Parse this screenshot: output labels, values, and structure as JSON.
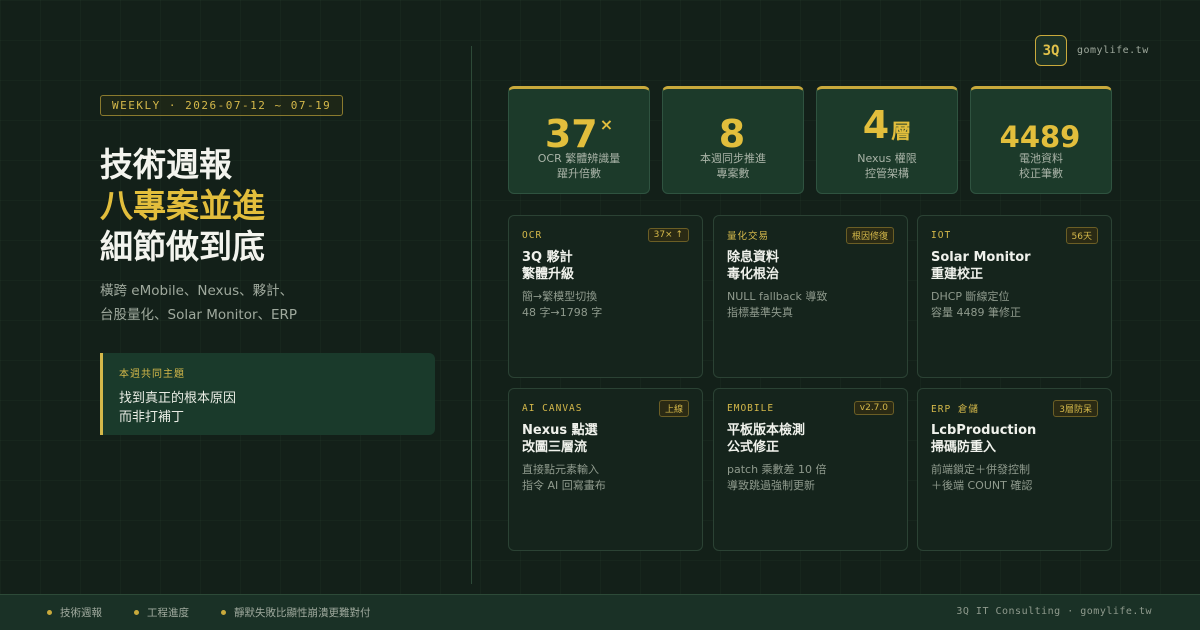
{
  "left": {
    "weekly_tag": "WEEKLY · 2026-07-12 ~ 07-19",
    "headline": [
      "技術週報",
      "八專案並進",
      "細節做到底"
    ],
    "intro": [
      "橫跨 eMobile、Nexus、夥計、",
      "台股量化、Solar Monitor、ERP"
    ],
    "theme_label": "本週共同主題",
    "theme_lines": [
      "找到真正的根本原因",
      "而非打補丁"
    ]
  },
  "brand": {
    "logo": "3Q",
    "url": "gomylife.tw"
  },
  "stats": [
    {
      "value": "37",
      "suffix": "×",
      "label": [
        "OCR 繁體辨識量",
        "躍升倍數"
      ]
    },
    {
      "value": "8",
      "suffix": "",
      "label": [
        "本週同步推進",
        "專案數"
      ]
    },
    {
      "value": "4",
      "suffix": "層",
      "label": [
        "Nexus 權限",
        "控管架構"
      ]
    },
    {
      "value": "4489",
      "suffix": "",
      "label": [
        "電池資料",
        "校正筆數"
      ]
    }
  ],
  "cards": [
    {
      "cat": "OCR",
      "badge": "37× ↑",
      "title": [
        "3Q 夥計",
        "繁體升級"
      ],
      "desc": [
        "簡→繁模型切換",
        "48 字→1798 字"
      ]
    },
    {
      "cat": "量化交易",
      "badge": "根因修復",
      "title": [
        "除息資料",
        "毒化根治"
      ],
      "desc": [
        "NULL fallback 導致",
        "指標基準失真"
      ]
    },
    {
      "cat": "IOT",
      "badge": "56天",
      "title": [
        "Solar Monitor",
        "重建校正"
      ],
      "desc": [
        "DHCP 斷線定位",
        "容量 4489 筆修正"
      ]
    },
    {
      "cat": "AI CANVAS",
      "badge": "上線",
      "title": [
        "Nexus 點選",
        "改圖三層流"
      ],
      "desc": [
        "直接點元素輸入",
        "指令 AI 回寫畫布"
      ]
    },
    {
      "cat": "EMOBILE",
      "badge": "v2.7.0",
      "title": [
        "平板版本檢測",
        "公式修正"
      ],
      "desc": [
        "patch 乘數差 10 倍",
        "導致跳過強制更新"
      ]
    },
    {
      "cat": "ERP 倉儲",
      "badge": "3層防呆",
      "title": [
        "LcbProduction",
        "掃碼防重入"
      ],
      "desc": [
        "前端鎖定＋併發控制",
        "＋後端 COUNT 確認"
      ]
    }
  ],
  "footer": {
    "items": [
      "技術週報",
      "工程進度",
      "靜默失敗比顯性崩潰更難對付"
    ],
    "right": "3Q IT Consulting · gomylife.tw"
  },
  "colors": {
    "accent": "#e2be3c",
    "background": "#132019",
    "card": "#15241c"
  }
}
